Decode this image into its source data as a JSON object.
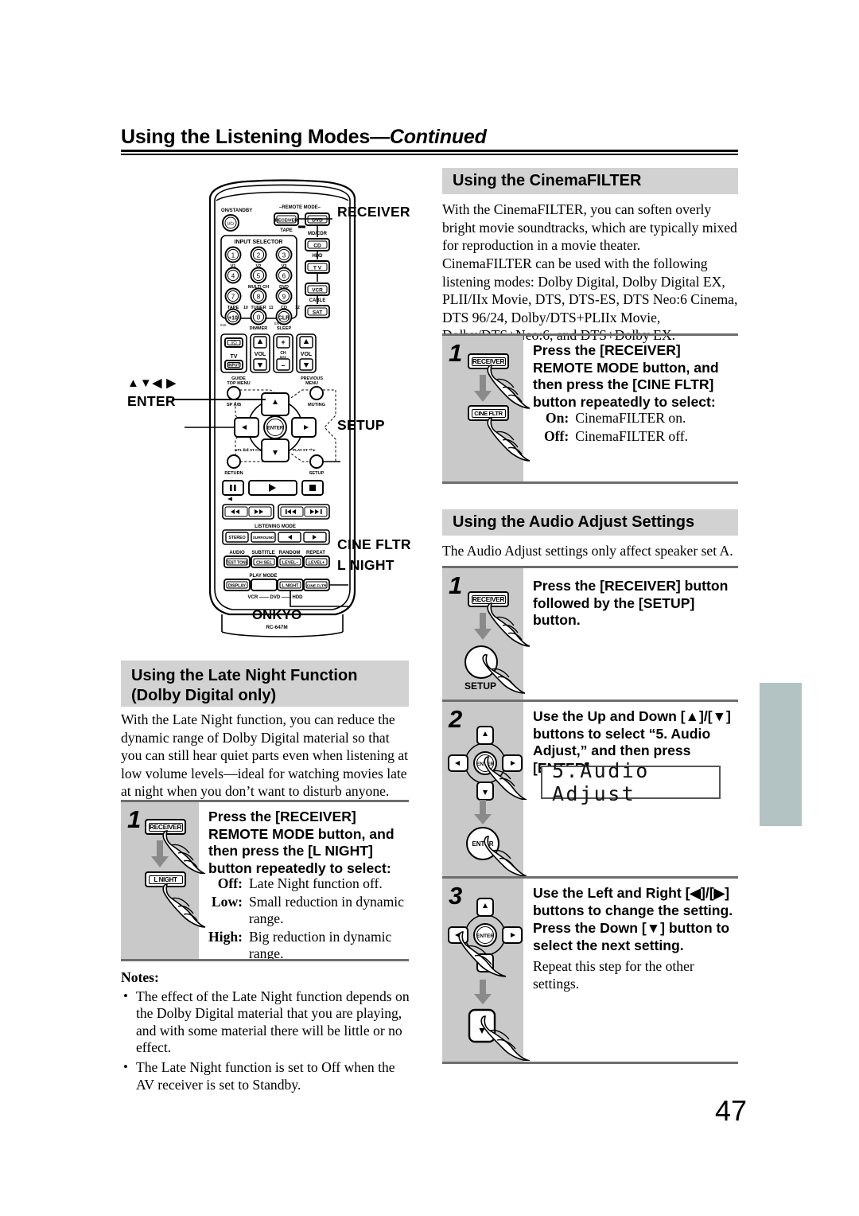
{
  "header": {
    "title_main": "Using the Listening Modes",
    "title_cont": "—Continued"
  },
  "page_number": "47",
  "remote": {
    "model_brand": "ONKYO",
    "model_code": "RC-647M",
    "callouts": [
      {
        "name": "receiver",
        "label": "RECEIVER"
      },
      {
        "name": "arrows-enter",
        "label_arrows": "▲▼◀ ▶",
        "label": "ENTER"
      },
      {
        "name": "setup",
        "label": "SETUP"
      },
      {
        "name": "cine-fltr",
        "label": "CINE FLTR"
      },
      {
        "name": "l-night",
        "label": "L NIGHT"
      }
    ],
    "keys": {
      "on_standby": "ON/STANDBY",
      "remote_mode": "–REMOTE MODE–",
      "receiver": "RECEIVER",
      "dvd": "DVD",
      "tape": "TAPE",
      "md_cdr": "MD/CDR",
      "cd": "CD",
      "hdd": "HDD",
      "tv": "T V",
      "vcr": "VCR",
      "cable": "CABLE",
      "sat": "SAT",
      "input_selector": "INPUT SELECTOR",
      "num1": "1",
      "num2": "2",
      "num3": "3",
      "num4": "4",
      "num5": "5",
      "num6": "6",
      "num7": "7",
      "num8": "8",
      "num9": "9",
      "num0": "0",
      "plus10": "+10",
      "clr": "CLR",
      "sub_v1": "V1",
      "sub_v2": "V2",
      "sub_v3": "V3",
      "sub_multich": "MULTI CH",
      "sub_dvd": "DVD",
      "sub_tape": "TAPE",
      "sub_tuner": "TUNER",
      "sub_cd": "CD",
      "sub_dimmer": "DIMMER",
      "sub_sleep": "SLEEP",
      "sub_10": "10",
      "sub_11": "11",
      "sub_12": "12",
      "tv_power": "I/⏻",
      "input": "INPUT",
      "tv_label": "TV",
      "vol": "VOL",
      "ch": "CH",
      "guide_topmenu": "GUIDE\nTOP MENU",
      "previous_menu": "PREVIOUS\nMENU",
      "sp_ab": "SP A/B",
      "muting": "MUTING",
      "enter": "ENTER",
      "return": "RETURN",
      "setup": "SETUP",
      "listening_mode": "LISTENING MODE",
      "stereo": "STEREO",
      "surround": "SURROUND",
      "audio": "AUDIO",
      "subtitle": "SUBTITLE",
      "random": "RANDOM",
      "repeat": "REPEAT",
      "test_tone": "TEST TONE",
      "ch_sel": "CH SEL",
      "level_minus": "LEVEL–",
      "level_plus": "LEVEL+",
      "play_mode": "PLAY MODE",
      "display": "DISPLAY",
      "l_night": "L NIGHT",
      "cine_fltr": "CINE FLTR",
      "vcr_dvd_hdd": "VCR — DVD — HDD"
    }
  },
  "sections": {
    "cinemafilter": {
      "title": "Using the CinemaFILTER",
      "paragraphs": [
        "With the CinemaFILTER, you can soften overly bright movie soundtracks, which are typically mixed for reproduction in a movie theater.",
        "CinemaFILTER can be used with the following listening modes: Dolby Digital, Dolby Digital EX, PLII/IIx Movie, DTS, DTS-ES, DTS Neo:6 Cinema, DTS 96/24, Dolby/DTS+PLIIx Movie, Dolby/DTS+Neo:6, and DTS+Dolby EX."
      ],
      "step1": {
        "num": "1",
        "text": "Press the [RECEIVER] REMOTE MODE button, and then press the [CINE FLTR] button repeatedly to select:",
        "btn_top": "RECEIVER",
        "btn_bottom": "CINE FLTR",
        "options": [
          {
            "key": "On:",
            "val": "CinemaFILTER on."
          },
          {
            "key": "Off:",
            "val": "CinemaFILTER off."
          }
        ]
      }
    },
    "audio_adjust": {
      "title": "Using the Audio Adjust Settings",
      "intro": "The Audio Adjust settings only affect speaker set A.",
      "step1": {
        "num": "1",
        "text": "Press the [RECEIVER] button followed by the [SETUP] button.",
        "btn_top": "RECEIVER",
        "btn_bottom_label": "SETUP"
      },
      "step2": {
        "num": "2",
        "text": "Use the Up and Down [▲]/[▼] buttons to select “5. Audio Adjust,” and then press [ENTER].",
        "enter_label": "ENTER",
        "lcd": "5.Audio Adjust"
      },
      "step3": {
        "num": "3",
        "text_a": "Use the Left and Right [◀]/[▶] buttons to change the setting.",
        "text_b": "Press the Down [▼] button to select the next setting.",
        "note": "Repeat this step for the other settings.",
        "enter_label": "ENTER"
      }
    },
    "late_night": {
      "title_line1": "Using the Late Night Function",
      "title_line2": "(Dolby Digital only)",
      "paragraph": "With the Late Night function, you can reduce the dynamic range of Dolby Digital material so that you can still hear quiet parts even when listening at low volume levels—ideal for watching movies late at night when you don’t want to disturb anyone.",
      "step1": {
        "num": "1",
        "text": "Press the [RECEIVER] REMOTE MODE button, and then press the [L NIGHT] button repeatedly to select:",
        "btn_top": "RECEIVER",
        "btn_bottom": "L NIGHT",
        "options": [
          {
            "key": "Off:",
            "val": "Late Night function off."
          },
          {
            "key": "Low:",
            "val": "Small reduction in dynamic range."
          },
          {
            "key": "High:",
            "val": "Big reduction in dynamic range."
          }
        ]
      },
      "notes_heading": "Notes:",
      "notes": [
        "The effect of the Late Night function depends on the Dolby Digital material that you are playing, and with some material there will be little or no effect.",
        "The Late Night function is set to Off when the AV receiver is set to Standby."
      ]
    }
  },
  "colors": {
    "section_bar": "#d2d2d2",
    "step_gray": "#c9c9c9",
    "side_tab": "#b3c2c2",
    "rule": "#6e6e6e"
  }
}
